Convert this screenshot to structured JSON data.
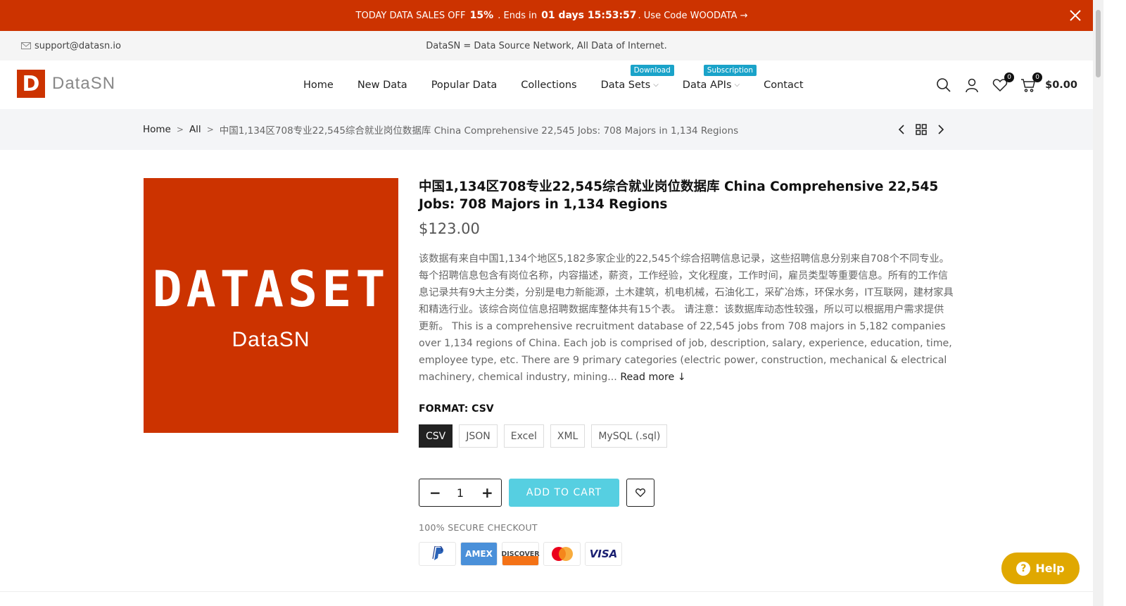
{
  "promo": {
    "prefix": "TODAY DATA SALES OFF",
    "discount": "15%",
    "ends_in": ". Ends in",
    "countdown": "01 days 15:53:57",
    "code_text": ". Use Code WOODATA →"
  },
  "topbar": {
    "email": "support@datasn.io",
    "tagline": "DataSN = Data Source Network, All Data of Internet."
  },
  "header": {
    "logo_letter": "D",
    "logo_text": "DataSN",
    "nav": [
      {
        "label": "Home"
      },
      {
        "label": "New Data"
      },
      {
        "label": "Popular Data"
      },
      {
        "label": "Collections"
      },
      {
        "label": "Data Sets",
        "badge": "Download"
      },
      {
        "label": "Data APIs",
        "badge": "Subscription"
      },
      {
        "label": "Contact"
      }
    ],
    "wishlist_count": "0",
    "cart_count": "0",
    "cart_total": "$0.00"
  },
  "breadcrumb": {
    "home": "Home",
    "all": "All",
    "current": "中国1,134区708专业22,545综合就业岗位数据库 China Comprehensive 22,545 Jobs: 708 Majors in 1,134 Regions"
  },
  "product": {
    "image_title": "DATASET",
    "image_subtitle": "DataSN",
    "title": "中国1,134区708专业22,545综合就业岗位数据库 China Comprehensive 22,545 Jobs: 708 Majors in 1,134 Regions",
    "price": "$123.00",
    "description": "该数据有来自中国1,134个地区5,182多家企业的22,545个综合招聘信息记录，这些招聘信息分别来自708个不同专业。每个招聘信息包含有岗位名称，内容描述，薪资，工作经验，文化程度，工作时间，雇员类型等重要信息。所有的工作信息记录共有9大主分类，分别是电力新能源，土木建筑，机电机械，石油化工，采矿冶炼，环保水务，IT互联网，建材家具和精选行业。该综合岗位信息招聘数据库整体共有15个表。 请注意：该数据库动态性较强，所以可以根据用户需求提供更新。 This is a comprehensive recruitment database of 22,545 jobs from 708 majors in 5,182 companies over 1,134 regions of China. Each job is comprised of job, description, salary, experience, education, time, employee type, etc. There are 9 primary categories (electric power, construction, mechanical & electrical machinery, chemical industry, mining...",
    "read_more": "Read more ↓",
    "format_label": "FORMAT: CSV",
    "formats": [
      "CSV",
      "JSON",
      "Excel",
      "XML",
      "MySQL (.sql)"
    ],
    "selected_format": "CSV",
    "quantity": "1",
    "add_to_cart": "ADD TO CART",
    "secure_checkout": "100% SECURE CHECKOUT",
    "payments": [
      "PayPal",
      "AMEX",
      "DISCOVER",
      "Mastercard",
      "VISA"
    ]
  },
  "help": {
    "label": "Help"
  },
  "colors": {
    "brand": "#cc3300",
    "accent": "#56cfe1",
    "badge": "#1aa3c9",
    "help": "#e0a800"
  }
}
